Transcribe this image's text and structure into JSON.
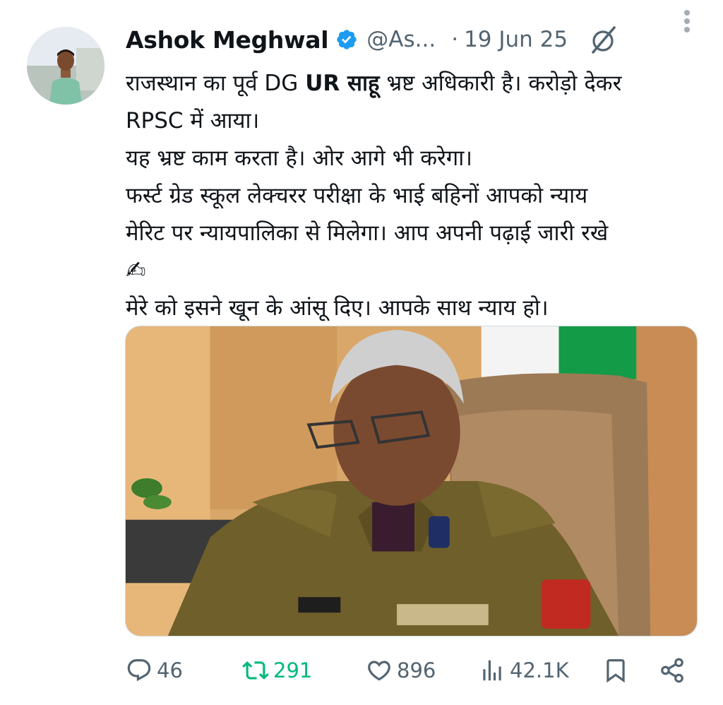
{
  "author": {
    "name": "Ashok Meghwal",
    "handle": "@As...",
    "separator": "·",
    "date": "19 Jun 25",
    "verified": true
  },
  "tweet": {
    "line1_pre": "राजस्थान का पूर्व DG ",
    "line1_bold": "UR साहू",
    "line1_post": " भ्रष्ट अधिकारी है। करोड़ो देकर",
    "line2": "RPSC में आया।",
    "line3": "यह भ्रष्ट काम करता है। ओर आगे भी करेगा।",
    "line4": "फर्स्ट ग्रेड स्कूल लेक्चरर परीक्षा के भाई बहिनों आपको न्याय",
    "line5": "मेरिट पर न्यायपालिका से मिलेगा। आप अपनी पढ़ाई जारी रखे",
    "line6": "✍",
    "line7": "मेरे को इसने खून के आंसू दिए। आपके साथ न्याय हो।"
  },
  "actions": {
    "replies": "46",
    "reposts": "291",
    "likes": "896",
    "views": "42.1K"
  },
  "icons": {
    "verified": "verified-badge-icon",
    "grok": "grok-icon",
    "more": "more-options-icon",
    "reply": "reply-icon",
    "repost": "repost-icon",
    "like": "like-icon",
    "views": "views-icon",
    "bookmark": "bookmark-icon",
    "share": "share-icon"
  },
  "colors": {
    "accent_blue": "#1d9bf0",
    "repost_green": "#00ba7c",
    "muted": "#536471"
  }
}
